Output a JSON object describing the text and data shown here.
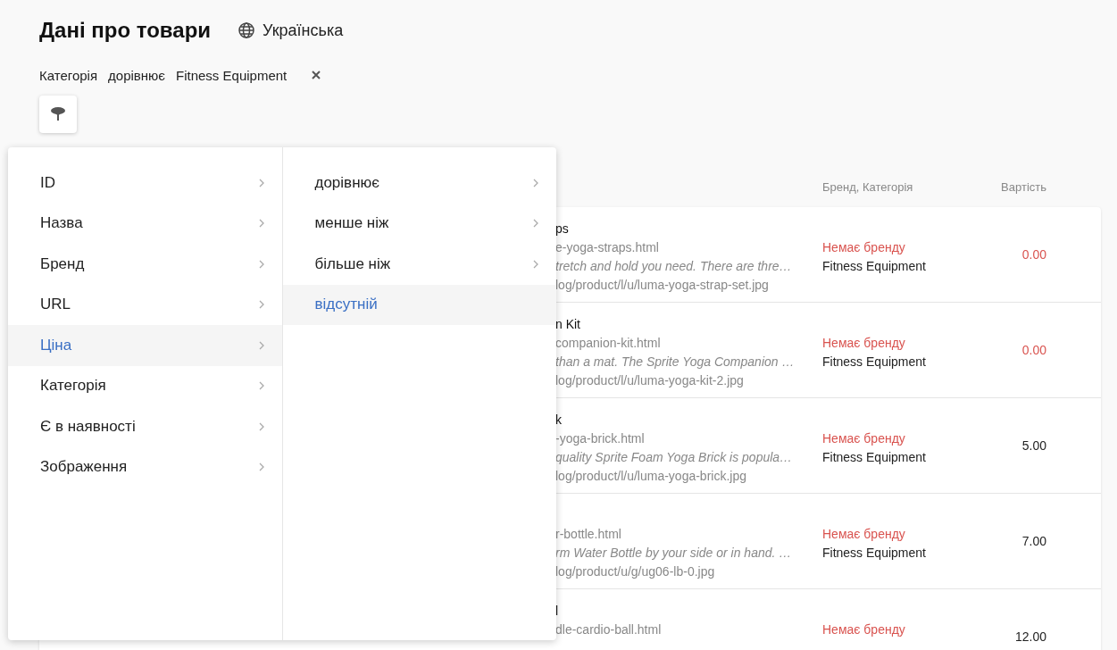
{
  "header": {
    "title": "Дані про товари",
    "language": "Українська"
  },
  "active_filter": {
    "field": "Категорія",
    "operator": "дорівнює",
    "value": "Fitness Equipment"
  },
  "table": {
    "columns": [
      "Бренд, Категорія",
      "Вартість"
    ],
    "rows": [
      {
        "title": "ps",
        "url": "e-yoga-straps.html",
        "description": "tretch and hold you need. There are thre…",
        "image": "log/product/l/u/luma-yoga-strap-set.jpg",
        "brand": "Немає бренду",
        "category": "Fitness Equipment",
        "price": "0.00",
        "price_missing": true
      },
      {
        "title": "n Kit",
        "url": "companion-kit.html",
        "description": "than a mat. The Sprite Yoga Companion …",
        "image": "log/product/l/u/luma-yoga-kit-2.jpg",
        "brand": "Немає бренду",
        "category": "Fitness Equipment",
        "price": "0.00",
        "price_missing": true
      },
      {
        "title": "k",
        "url": "-yoga-brick.html",
        "description": "quality Sprite Foam Yoga Brick is popula…",
        "image": "log/product/l/u/luma-yoga-brick.jpg",
        "brand": "Немає бренду",
        "category": "Fitness Equipment",
        "price": "5.00",
        "price_missing": false
      },
      {
        "url": "r-bottle.html",
        "description": "rm Water Bottle by your side or in hand. …",
        "image": "log/product/u/g/ug06-lb-0.jpg",
        "brand": "Немає бренду",
        "category": "Fitness Equipment",
        "price": "7.00",
        "price_missing": false
      },
      {
        "title": "l",
        "url": "dle-cardio-ball.html",
        "brand": "Немає бренду",
        "price": "12.00",
        "price_missing": false
      }
    ]
  },
  "filter_menu": {
    "fields": [
      {
        "label": "ID",
        "selected": false
      },
      {
        "label": "Назва",
        "selected": false
      },
      {
        "label": "Бренд",
        "selected": false
      },
      {
        "label": "URL",
        "selected": false
      },
      {
        "label": "Ціна",
        "selected": true
      },
      {
        "label": "Категорія",
        "selected": false
      },
      {
        "label": "Є в наявності",
        "selected": false
      },
      {
        "label": "Зображення",
        "selected": false
      }
    ],
    "operators": [
      {
        "label": "дорівнює",
        "selected": false,
        "has_submenu": true
      },
      {
        "label": "менше ніж",
        "selected": false,
        "has_submenu": true
      },
      {
        "label": "більше ніж",
        "selected": false,
        "has_submenu": true
      },
      {
        "label": "відсутній",
        "selected": true,
        "has_submenu": false
      }
    ]
  }
}
